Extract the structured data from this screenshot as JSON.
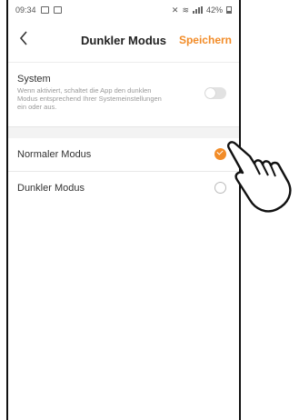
{
  "status_bar": {
    "time": "09:34",
    "battery": "42%"
  },
  "nav": {
    "back_icon": "chevron-left-icon",
    "title": "Dunkler Modus",
    "save_label": "Speichern"
  },
  "system": {
    "title": "System",
    "description": "Wenn aktiviert, schaltet die App den dunklen Modus entsprechend Ihrer Systemeinstellungen ein oder aus.",
    "enabled": false
  },
  "options": [
    {
      "label": "Normaler Modus",
      "selected": true
    },
    {
      "label": "Dunkler Modus",
      "selected": false
    }
  ],
  "colors": {
    "accent": "#f28c28",
    "toggle_off": "#e2e2e2"
  }
}
